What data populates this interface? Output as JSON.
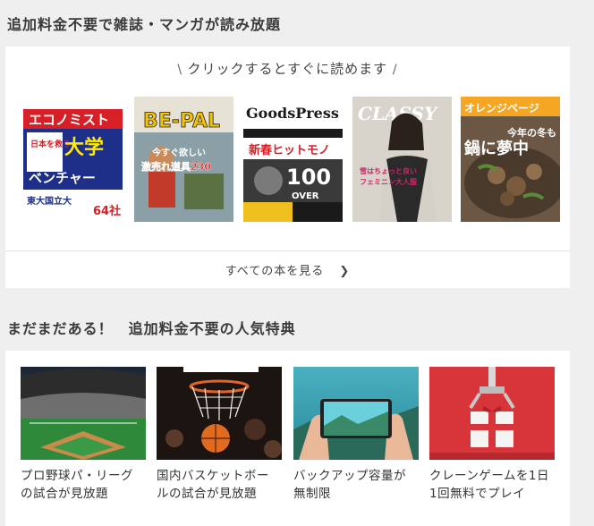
{
  "section1": {
    "title": "追加料金不要で雑誌・マンガが読み放題",
    "hint": "クリックするとすぐに読めます",
    "see_all": "すべての本を見る",
    "magazines": [
      {
        "name": "エコノミスト",
        "cover_lines": [
          "エコノミスト",
          "日本を救う",
          "大学",
          "ベンチャー",
          "東大国立大",
          "64社"
        ]
      },
      {
        "name": "BE-PAL",
        "cover_lines": [
          "BE-PAL",
          "今すぐ欲しい",
          "激売れ道具230"
        ]
      },
      {
        "name": "GoodsPress",
        "cover_lines": [
          "GoodsPress",
          "新春ヒットモノ",
          "100",
          "OVER"
        ]
      },
      {
        "name": "CLASSY",
        "cover_lines": [
          "CLASSY",
          "雪はちょっと良い",
          "フェミニン大人服"
        ]
      },
      {
        "name": "オレンジページ",
        "cover_lines": [
          "オレンジページ",
          "今年の冬も",
          "鍋に夢中"
        ]
      }
    ]
  },
  "section2": {
    "title": "まだまだある！　追加料金不要の人気特典",
    "perks": [
      {
        "label": "プロ野球パ・リーグ\nの試合が見放題",
        "icon": "baseball-stadium"
      },
      {
        "label": "国内バスケットボー\nルの試合が見放題",
        "icon": "basketball-hoop"
      },
      {
        "label": "バックアップ容量が\n無制限",
        "icon": "smartphone-photo"
      },
      {
        "label": "クレーンゲームを1日\n1回無料でプレイ",
        "icon": "crane-game-gift"
      }
    ]
  },
  "colors": {
    "background": "#efefef",
    "card": "#ffffff",
    "text": "#333333"
  }
}
